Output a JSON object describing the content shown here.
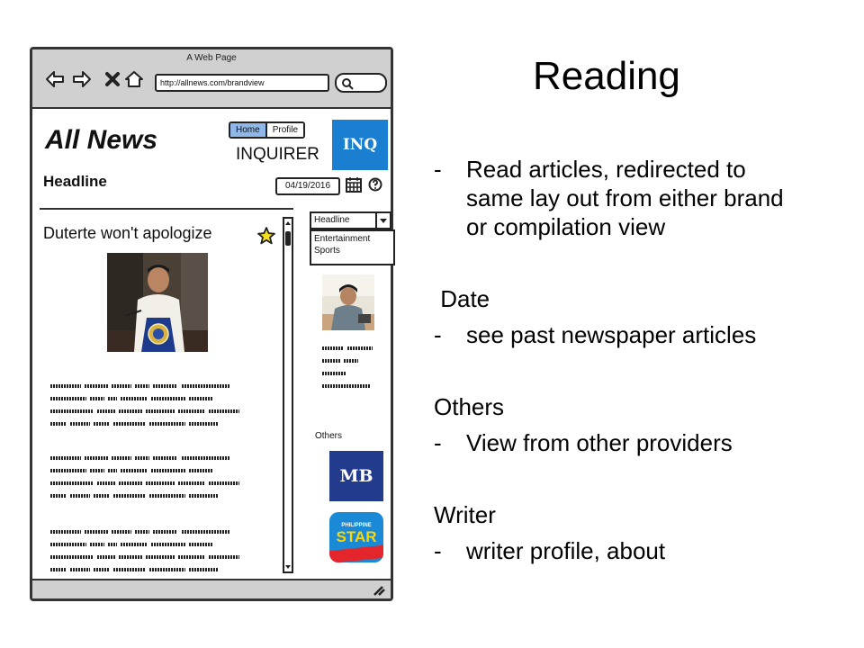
{
  "slide": {
    "title": "Reading",
    "sections": [
      {
        "heading": "",
        "bullet_marker": "-",
        "bullet": "Read articles, redirected to same lay out  from either brand or compilation view"
      },
      {
        "heading": " Date",
        "bullet_marker": "-",
        "bullet": "see past newspaper articles"
      },
      {
        "heading": "Others",
        "bullet_marker": "-",
        "bullet": "View from other providers"
      },
      {
        "heading": "Writer",
        "bullet_marker": "-",
        "bullet": "writer profile, about"
      }
    ]
  },
  "mockup": {
    "window_title": "A Web Page",
    "url": "http://allnews.com/brandview",
    "nav_icons": [
      "back-arrow-icon",
      "forward-arrow-icon",
      "close-icon",
      "home-icon"
    ],
    "brand_title": "All News",
    "tabs": [
      {
        "label": "Home",
        "active": true
      },
      {
        "label": "Profile",
        "active": false
      }
    ],
    "publisher_name": "INQUIRER",
    "publisher_logo_text": "INQ",
    "headline_label": "Headline",
    "date": "04/19/2016",
    "article_title": "Duterte won't apologize",
    "category_select": {
      "selected": "Headline",
      "options": [
        "Entertainment",
        "Sports"
      ]
    },
    "others_label": "Others",
    "other_providers": [
      {
        "logo_text": "MB",
        "color": "#233b8c"
      },
      {
        "logo_small_text": "PHILIPPINE",
        "logo_text": "STAR",
        "color": "#1a8ad6"
      }
    ]
  }
}
